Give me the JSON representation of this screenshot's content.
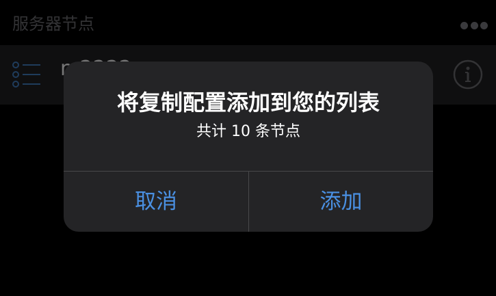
{
  "section": {
    "title": "服务器节点",
    "more_icon": "ellipsis-icon"
  },
  "row": {
    "label": "n 2222",
    "leading_icon": "list-icon",
    "trailing_icon": "info-icon"
  },
  "alert": {
    "title": "将复制配置添加到您的列表",
    "message": "共计 10 条节点",
    "cancel_label": "取消",
    "confirm_label": "添加"
  },
  "colors": {
    "accent": "#4a90e2",
    "background": "#000000",
    "row_background": "#1c1c1e",
    "alert_background": "#242426",
    "muted_text": "#5d5d62"
  }
}
